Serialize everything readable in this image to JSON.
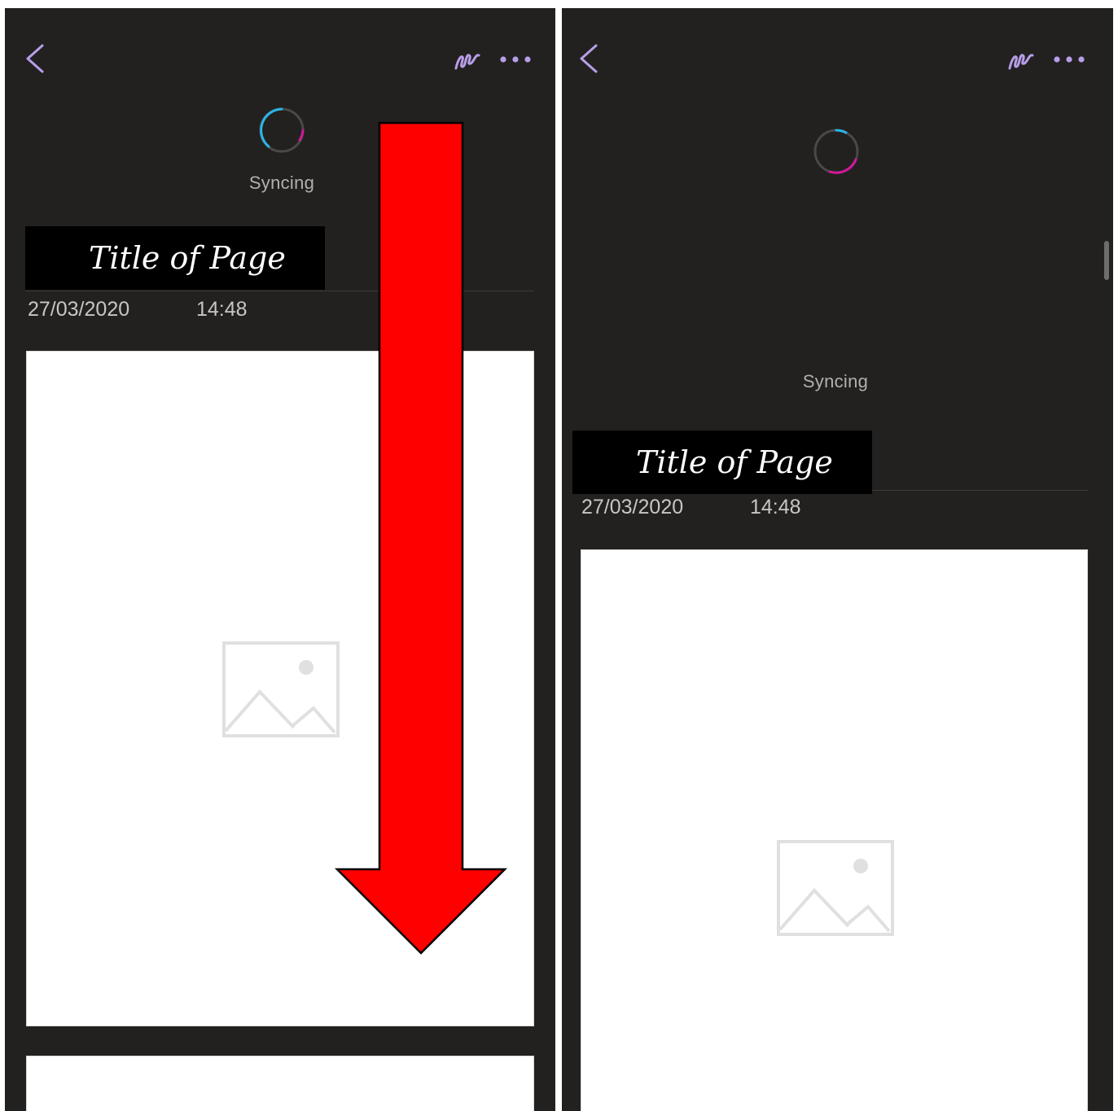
{
  "screens": [
    {
      "name": "before",
      "status": "Syncing",
      "page_title": "Title of Page",
      "date": "27/03/2020",
      "time": "14:48",
      "toolbar": {
        "back_icon": "chevron-left-icon",
        "pen_icon": "pen-squiggle-icon",
        "more_icon": "more-dots-icon"
      }
    },
    {
      "name": "after",
      "status": "Syncing",
      "page_title": "Title of Page",
      "date": "27/03/2020",
      "time": "14:48",
      "toolbar": {
        "back_icon": "chevron-left-icon",
        "pen_icon": "pen-squiggle-icon",
        "more_icon": "more-dots-icon"
      }
    }
  ],
  "colors": {
    "app_background": "#222120",
    "accent_purple": "#b89ee8",
    "spinner_cyan": "#29b6e8",
    "spinner_magenta": "#d1189b",
    "annotation_arrow": "#ff0000"
  },
  "annotation": {
    "type": "arrow",
    "direction": "down",
    "meaning": "pull down to refresh"
  }
}
